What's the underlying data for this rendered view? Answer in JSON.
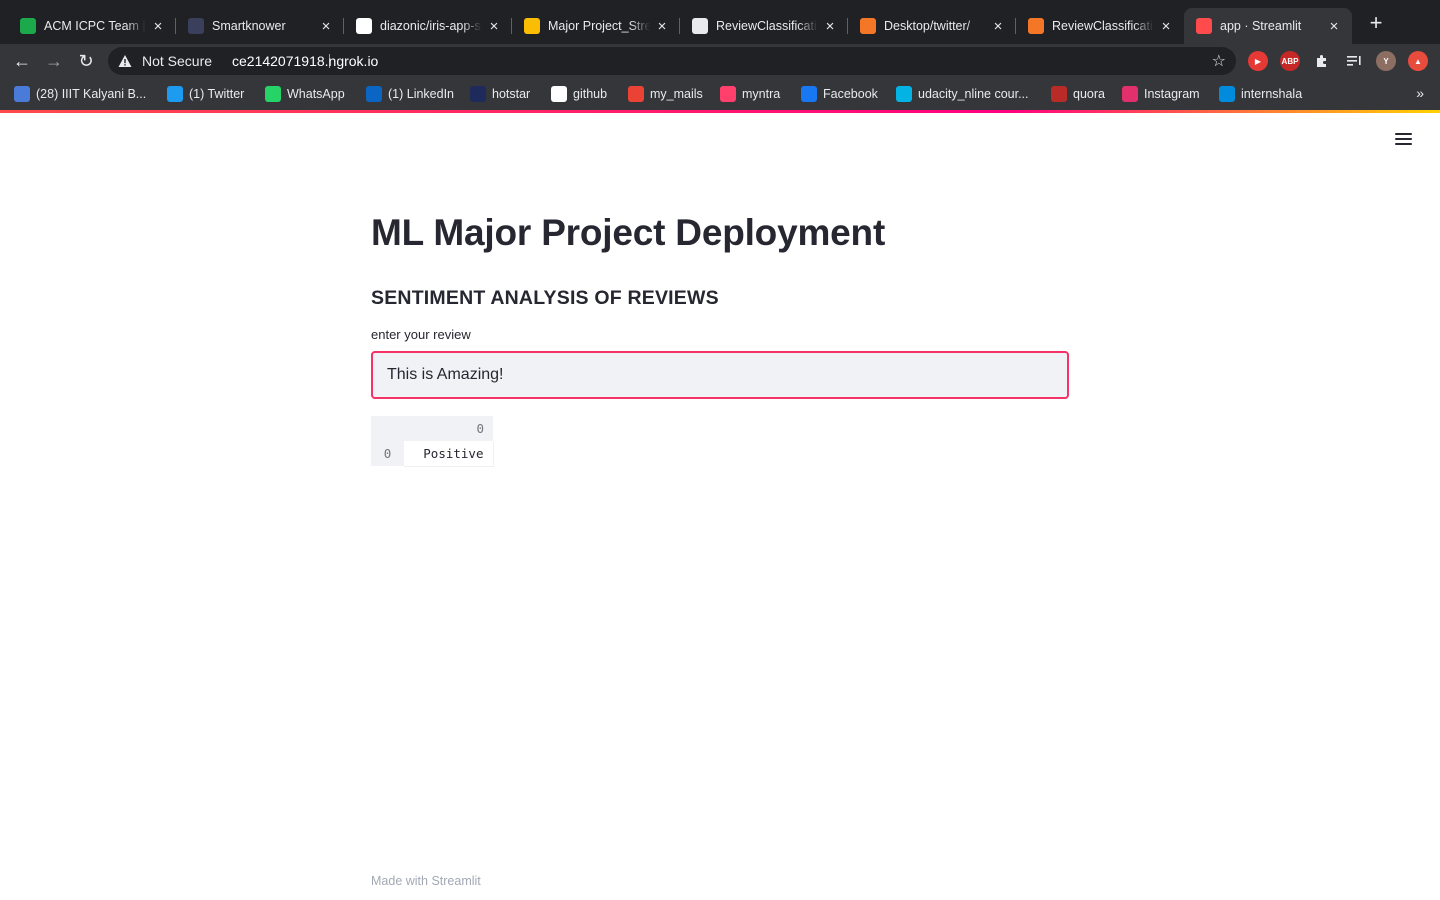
{
  "browser": {
    "tabs": [
      {
        "title": "ACM ICPC Team | H",
        "icon": "hackerrank-icon",
        "color": "#1ba94c"
      },
      {
        "title": "Smartknower",
        "icon": "smartknower-icon",
        "color": "#3a3f5c"
      },
      {
        "title": "diazonic/iris-app-st",
        "icon": "github-icon",
        "color": "#ffffff"
      },
      {
        "title": "Major Project_Strea",
        "icon": "google-drive-icon",
        "color": "#fbbc04"
      },
      {
        "title": "ReviewClassificatio",
        "icon": "colab-icon",
        "color": "#e8eaed"
      },
      {
        "title": "Desktop/twitter/",
        "icon": "jupyter-icon",
        "color": "#f37726"
      },
      {
        "title": "ReviewClassificatio",
        "icon": "book-icon",
        "color": "#f37726"
      },
      {
        "title": "app · Streamlit",
        "icon": "streamlit-icon",
        "color": "#ff4b4b",
        "active": true
      }
    ],
    "address": {
      "security_label": "Not Secure",
      "url": "ce2142071918.ngrok.io"
    },
    "bookmarks": [
      {
        "label": "(28) IIIT Kalyani B...",
        "icon": "chat-icon",
        "color": "#4a7bd8"
      },
      {
        "label": "(1) Twitter",
        "icon": "twitter-icon",
        "color": "#1d9bf0"
      },
      {
        "label": "WhatsApp",
        "icon": "whatsapp-icon",
        "color": "#25d366"
      },
      {
        "label": "(1) LinkedIn",
        "icon": "linkedin-icon",
        "color": "#0a66c2"
      },
      {
        "label": "hotstar",
        "icon": "hotstar-icon",
        "color": "#1f2a5c"
      },
      {
        "label": "github",
        "icon": "github-icon",
        "color": "#ffffff"
      },
      {
        "label": "my_mails",
        "icon": "gmail-icon",
        "color": "#ea4335"
      },
      {
        "label": "myntra",
        "icon": "myntra-icon",
        "color": "#ff3f6c"
      },
      {
        "label": "Facebook",
        "icon": "facebook-icon",
        "color": "#1877f2"
      },
      {
        "label": "udacity_nline cour...",
        "icon": "udacity-icon",
        "color": "#02b3e4"
      },
      {
        "label": "quora",
        "icon": "quora-icon",
        "color": "#b92b27"
      },
      {
        "label": "Instagram",
        "icon": "instagram-icon",
        "color": "#e1306c"
      },
      {
        "label": "internshala",
        "icon": "internshala-icon",
        "color": "#008bdc"
      }
    ],
    "extensions": [
      {
        "name": "screencast-icon",
        "color": "#e53935",
        "text": "▶"
      },
      {
        "name": "adblock-icon",
        "color": "#c62828",
        "text": "ABP"
      },
      {
        "name": "puzzle-icon",
        "color": "transparent",
        "text": ""
      },
      {
        "name": "reading-list-icon",
        "color": "transparent",
        "text": ""
      },
      {
        "name": "profile-avatar",
        "color": "#8d6e63",
        "text": "Y"
      },
      {
        "name": "update-icon",
        "color": "#e74c3c",
        "text": "▲"
      }
    ]
  },
  "app": {
    "title": "ML Major Project Deployment",
    "subtitle": "SENTIMENT ANALYSIS OF REVIEWS",
    "input_label": "enter your review",
    "input_value": "This is Amazing!",
    "result_table": {
      "column_header": "0",
      "rows": [
        {
          "index": "0",
          "value": "Positive"
        }
      ]
    },
    "footer": "Made with Streamlit",
    "accent_color": "#f63366"
  }
}
